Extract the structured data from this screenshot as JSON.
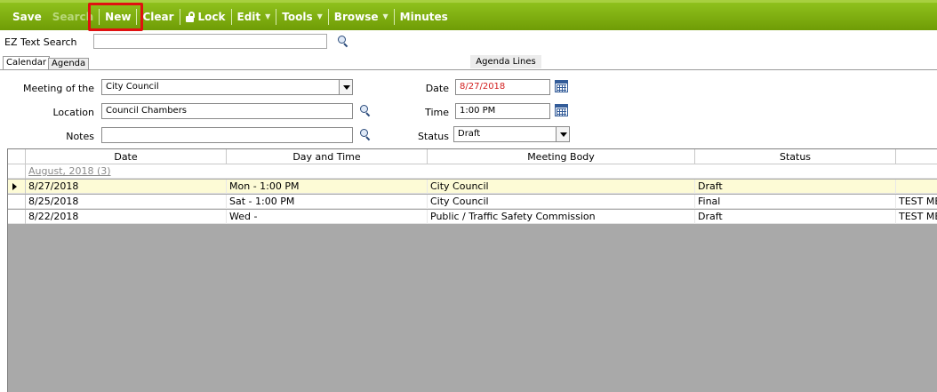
{
  "toolbar": {
    "save": "Save",
    "search": "Search",
    "new": "New",
    "clear": "Clear",
    "lock": "Lock",
    "edit": "Edit",
    "tools": "Tools",
    "browse": "Browse",
    "minutes": "Minutes",
    "accent_color": "#7fad10",
    "highlight_color": "#e01010"
  },
  "ez_search": {
    "label": "EZ Text Search",
    "value": ""
  },
  "tabs": [
    {
      "label": "Calendar"
    },
    {
      "label": "Agenda"
    }
  ],
  "agenda_lines": {
    "label": "Agenda Lines"
  },
  "form": {
    "meeting_of_label": "Meeting of the",
    "meeting_of_value": "City Council",
    "location_label": "Location",
    "location_value": "Council Chambers",
    "notes_label": "Notes",
    "notes_value": "",
    "date_label": "Date",
    "date_value": "8/27/2018",
    "time_label": "Time",
    "time_value": "1:00 PM",
    "status_label": "Status",
    "status_value": "Draft"
  },
  "grid": {
    "columns": [
      "Date",
      "Day and Time",
      "Meeting Body",
      "Status",
      ""
    ],
    "group_label": "August, 2018 (3)",
    "rows": [
      {
        "date": "8/27/2018",
        "day_time": "Mon - 1:00 PM",
        "body": "City Council",
        "status": "Draft",
        "extra": "",
        "selected": true
      },
      {
        "date": "8/25/2018",
        "day_time": "Sat - 1:00 PM",
        "body": "City Council",
        "status": "Final",
        "extra": "TEST MEI",
        "selected": false
      },
      {
        "date": "8/22/2018",
        "day_time": "Wed -",
        "body": "Public / Traffic Safety Commission",
        "status": "Draft",
        "extra": "TEST MEI",
        "selected": false
      }
    ]
  }
}
